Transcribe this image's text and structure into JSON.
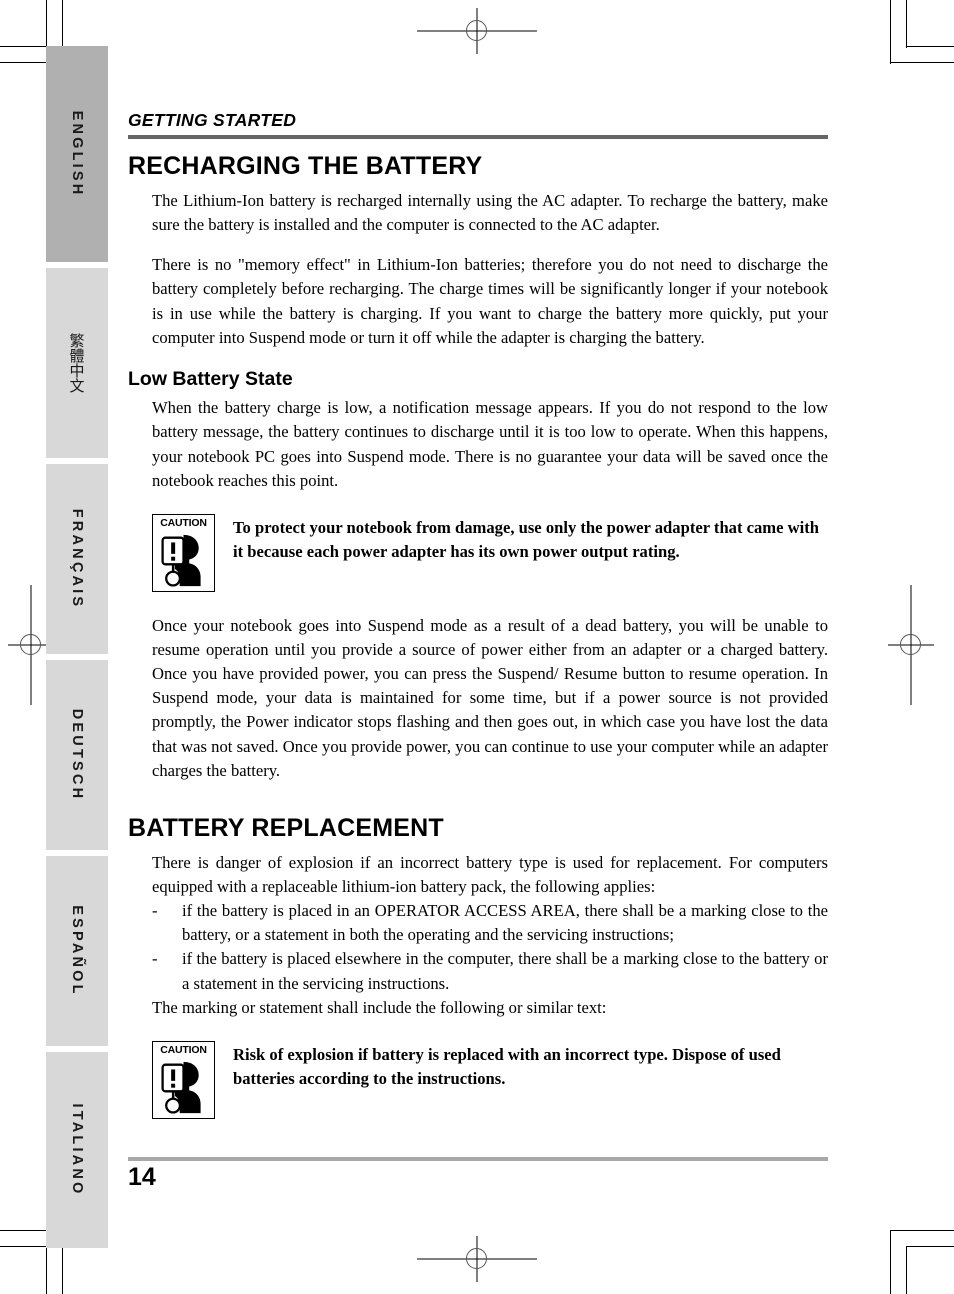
{
  "document": {
    "running_head": "GETTING STARTED",
    "page_number": "14"
  },
  "sidebar": {
    "tabs": [
      {
        "label": "ENGLISH",
        "active": true
      },
      {
        "label": "繁體中文",
        "active": false
      },
      {
        "label": "FRANÇAIS",
        "active": false
      },
      {
        "label": "DEUTSCH",
        "active": false
      },
      {
        "label": "ESPAÑOL",
        "active": false
      },
      {
        "label": "ITALIANO",
        "active": false
      }
    ]
  },
  "main": {
    "section1": {
      "title": "RECHARGING THE BATTERY",
      "para1": "The Lithium-Ion battery is recharged internally using the AC adapter. To recharge the battery, make sure the battery is installed and the computer is connected to the AC adapter.",
      "para2": "There is no \"memory effect\" in Lithium-Ion batteries; therefore you do not need to discharge the battery completely before recharging. The charge times will be significantly longer if your notebook is in use while the battery is charging. If you want to charge the battery more quickly, put your computer into Suspend mode or turn it off while the adapter is charging the battery.",
      "subsection": {
        "title": "Low Battery State",
        "para1": "When the battery charge is low, a notification message appears. If you do not respond to the low battery message, the battery continues to discharge until it is too low to operate. When this happens, your notebook PC goes into Suspend mode. There is no guarantee your data will be saved once the notebook reaches this point."
      },
      "caution1": {
        "icon_label": "CAUTION",
        "text": "To protect your notebook from damage, use only the power adapter that came with it because each power adapter has its own power output rating."
      },
      "para3": "Once your notebook goes into Suspend mode as a result of a dead battery, you will be unable to resume operation until you provide a source of power either from an adapter or a charged battery. Once you have provided power, you can press the Suspend/ Resume button to resume operation. In Suspend mode, your data is maintained for some time, but if a power source is not provided promptly, the Power indicator stops flashing and then goes out, in which case you have lost the data that was not saved. Once you provide power, you can continue to use your computer while an adapter charges the battery."
    },
    "section2": {
      "title": "BATTERY REPLACEMENT",
      "para1": "There is danger of explosion if an incorrect battery type is used for replacement. For computers equipped with a replaceable lithium-ion battery pack, the following applies:",
      "bullet_marker": "-",
      "bullets": [
        "if the battery is placed in an OPERATOR ACCESS AREA, there shall be a marking close to the battery, or a statement in both the operating and the servicing instructions;",
        "if the battery is placed elsewhere in the computer, there shall be a marking close to the battery or a statement in the servicing instructions."
      ],
      "para2": "The marking or statement shall include the following or similar text:",
      "caution2": {
        "icon_label": "CAUTION",
        "text": "Risk of explosion if battery is replaced with an incorrect type. Dispose of used batteries according to the instructions."
      }
    }
  },
  "colors": {
    "tab_active": "#b0b0b0",
    "tab_inactive": "#d8d8d8",
    "head_rule": "#666666",
    "foot_rule": "#a8a8a8",
    "text": "#000000"
  }
}
